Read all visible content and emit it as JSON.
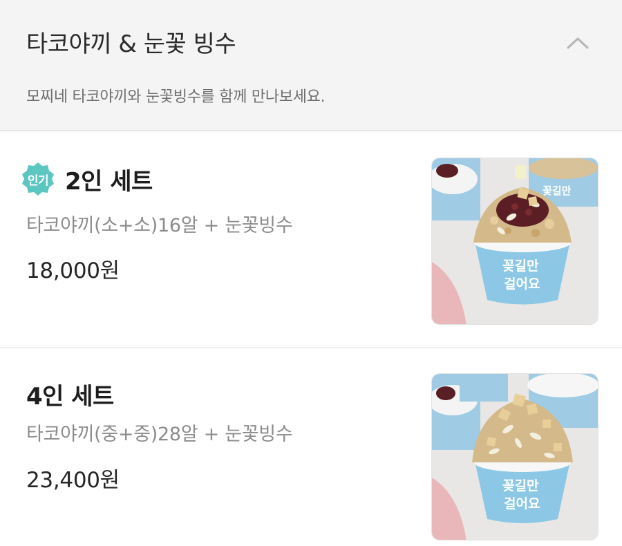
{
  "category": {
    "title": "타코야끼 & 눈꽃 빙수",
    "description": "모찌네 타코야끼와 눈꽃빙수를 함께 만나보세요.",
    "toggle_icon": "chevron-up-icon"
  },
  "items": [
    {
      "badge": "인기",
      "badge_color": "#5cc6c0",
      "name": "2인 세트",
      "description": "타코야끼(소+소)16알 + 눈꽃빙수",
      "price": "18,000원",
      "image_alt": "bingsu with red beans and injeolmi",
      "cup_text_1": "꽂길만",
      "cup_text_2": "걸어요"
    },
    {
      "name": "4인 세트",
      "description": "타코야끼(중+중)28알 + 눈꽃빙수",
      "price": "23,400원",
      "image_alt": "bingsu with injeolmi and almonds",
      "cup_text_1": "꽂길만",
      "cup_text_2": "걸어요"
    }
  ],
  "colors": {
    "header_bg": "#f4f4f4",
    "cup_blue": "#8cc8e6",
    "price_text": "#262626"
  }
}
